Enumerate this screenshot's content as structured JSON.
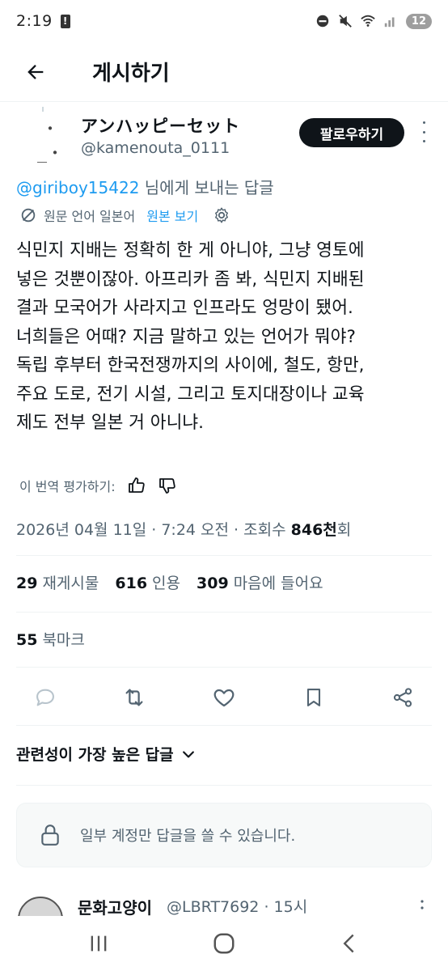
{
  "status_bar": {
    "time": "2:19",
    "notification_count": "12"
  },
  "header": {
    "title": "게시하기"
  },
  "author": {
    "avatar_text": "・_・",
    "name": "アンハッピーセット",
    "handle": "@kamenouta_0111",
    "follow_label": "팔로우하기"
  },
  "reply_to": {
    "mention": "@giriboy15422",
    "suffix": " 님에게 보내는 답글"
  },
  "translation": {
    "source_label": "원문 언어 일본어",
    "show_original": "원본 보기"
  },
  "post": {
    "lines": [
      "식민지 지배는 정확히 한 게 아니야, 그냥 영토에",
      "넣은 것뿐이잖아. 아프리카 좀 봐, 식민지 지배된",
      "결과 모국어가 사라지고 인프라도 엉망이 됐어.",
      "너희들은 어때? 지금 말하고 있는 언어가 뭐야?",
      "독립 후부터 한국전쟁까지의 사이에, 철도, 항만,",
      "주요 도로, 전기 시설, 그리고 토지대장이나 교육",
      "제도 전부 일본 거 아니냐."
    ]
  },
  "rating": {
    "label": "이 번역 평가하기:"
  },
  "meta": {
    "date": "2026년 04월 11일 · 7:24 오전 · 조회수 ",
    "views": "846천",
    "views_suffix": "회"
  },
  "stats": {
    "reposts_count": "29",
    "reposts_label": "재게시물",
    "quotes_count": "616",
    "quotes_label": "인용",
    "likes_count": "309",
    "likes_label": "마음에 들어요",
    "bookmarks_count": "55",
    "bookmarks_label": "북마크"
  },
  "sort": {
    "label": "관련성이 가장 높은 답글"
  },
  "restriction": {
    "text": "일부 계정만 답글을 쓸 수 있습니다."
  },
  "next_reply": {
    "name": "문화고양이",
    "meta": "@LBRT7692 · 15시"
  },
  "colors": {
    "accent": "#1d9bf0",
    "text": "#0f1419",
    "secondary": "#536471"
  }
}
